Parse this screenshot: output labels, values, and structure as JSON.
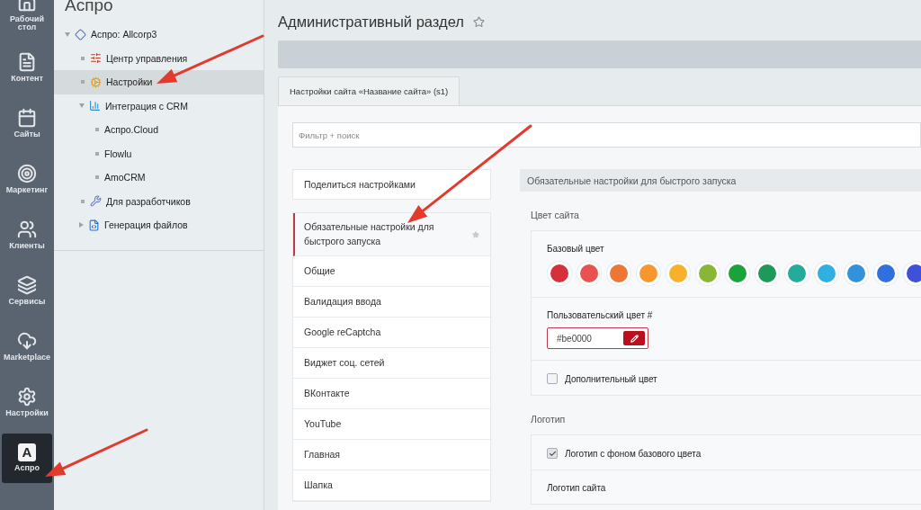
{
  "nav": [
    {
      "label": "Рабочий стол",
      "selected": false
    },
    {
      "label": "Контент",
      "selected": false
    },
    {
      "label": "Сайты",
      "selected": false
    },
    {
      "label": "Маркетинг",
      "selected": false
    },
    {
      "label": "Клиенты",
      "selected": false
    },
    {
      "label": "Сервисы",
      "selected": false
    },
    {
      "label": "Marketplace",
      "selected": false
    },
    {
      "label": "Настройки",
      "selected": false
    },
    {
      "label": "Аспро",
      "selected": true,
      "icon_letter": "A"
    }
  ],
  "menu_panel": {
    "title": "Аспро",
    "tree": [
      {
        "label": "Аспро: Allcorp3",
        "expanded": true,
        "selected": false,
        "children": [
          {
            "label": "Центр управления",
            "selected": false
          },
          {
            "label": "Настройки",
            "selected": true
          },
          {
            "label": "Интеграция с CRM",
            "expanded": true,
            "selected": false,
            "children": [
              {
                "label": "Аспро.Cloud",
                "selected": false
              },
              {
                "label": "Flowlu",
                "selected": false
              },
              {
                "label": "AmoCRM",
                "selected": false
              }
            ]
          },
          {
            "label": "Для разработчиков",
            "selected": false
          },
          {
            "label": "Генерация файлов",
            "expanded": false,
            "selected": false
          }
        ]
      }
    ]
  },
  "page": {
    "title": "Административный раздел",
    "favorite": false,
    "tabs": [
      {
        "label": "Настройки сайта «Название сайта» (s1)",
        "selected": true
      }
    ],
    "filter": {
      "placeholder": "Фильтр + поиск"
    },
    "share_button": "Поделиться настройками",
    "sections": [
      {
        "label": "Обязательные настройки для быстрого запуска",
        "selected": true,
        "favorite": false
      },
      {
        "label": "Общие",
        "selected": false
      },
      {
        "label": "Валидация ввода",
        "selected": false
      },
      {
        "label": "Google reCaptcha",
        "selected": false
      },
      {
        "label": "Виджет соц. сетей",
        "selected": false
      },
      {
        "label": "ВКонтакте",
        "selected": false
      },
      {
        "label": "YouTube",
        "selected": false
      },
      {
        "label": "Главная",
        "selected": false
      },
      {
        "label": "Шапка",
        "selected": false
      }
    ],
    "section_header": "Обязательные настройки для быстрого запуска",
    "site_color": {
      "title": "Цвет сайта",
      "base_label": "Базовый цвет",
      "swatches": [
        {
          "color": "#d6313a"
        },
        {
          "color": "#e8524f"
        },
        {
          "color": "#ee7634"
        },
        {
          "color": "#f7962c"
        },
        {
          "color": "#f8b12a"
        },
        {
          "color": "#8ab635"
        },
        {
          "color": "#1aa33a"
        },
        {
          "color": "#1d9a5a"
        },
        {
          "color": "#25ab9a"
        },
        {
          "color": "#2fb0e0"
        },
        {
          "color": "#3192dc"
        },
        {
          "color": "#3070de"
        },
        {
          "color": "#3f51d8"
        }
      ],
      "custom_label": "Пользовательский цвет #",
      "custom_value": "#be0000",
      "extra": {
        "label": "Дополнительный цвет",
        "checked": false
      }
    },
    "logo": {
      "title": "Логотип",
      "bg": {
        "label": "Логотип с фоном базового цвета",
        "checked": true
      },
      "site_logo_label": "Логотип сайта"
    }
  }
}
